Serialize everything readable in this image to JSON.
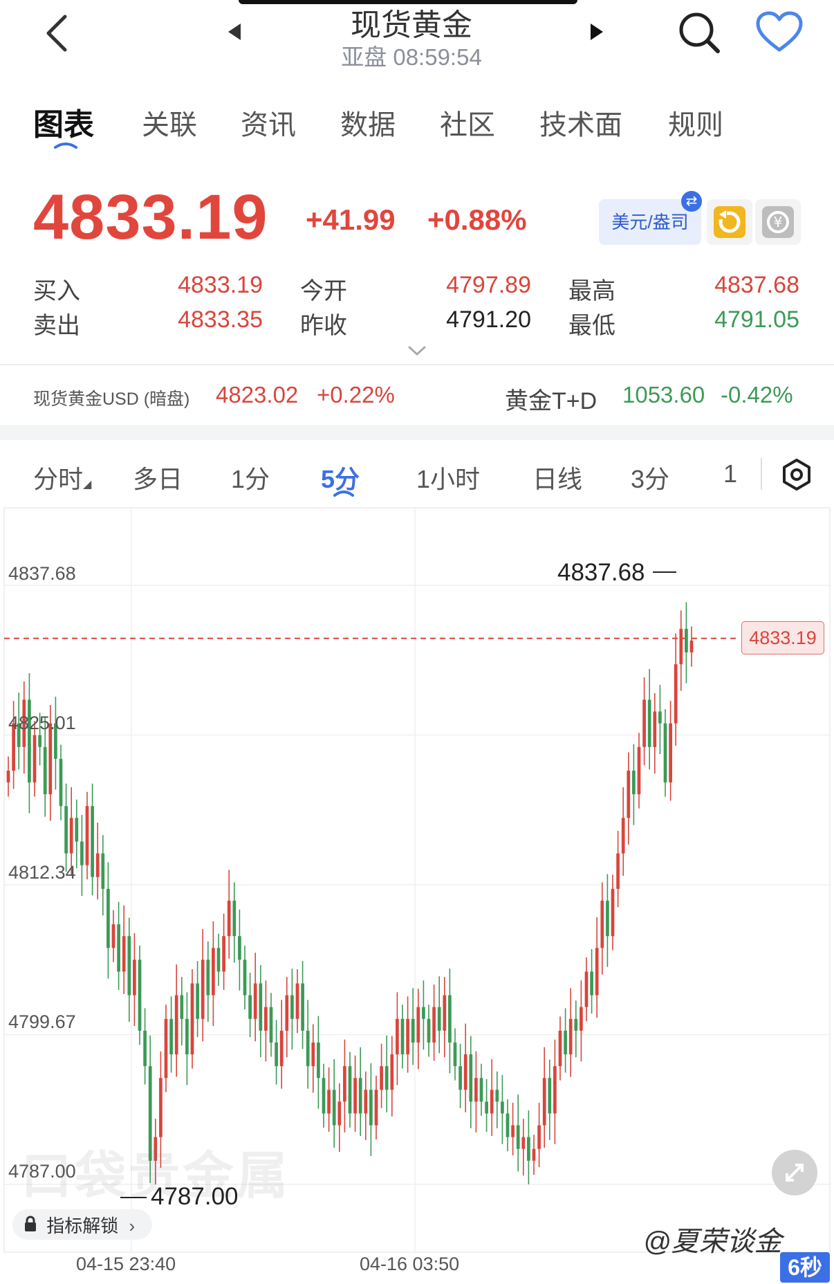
{
  "header": {
    "title": "现货黄金",
    "subtitle": "亚盘 08:59:54",
    "icons": [
      "back-icon",
      "prev-icon",
      "next-icon",
      "search-icon",
      "heart-icon"
    ]
  },
  "main_tabs": [
    "图表",
    "关联",
    "资讯",
    "数据",
    "社区",
    "技术面",
    "规则"
  ],
  "active_main_tab": "图表",
  "quote": {
    "price": "4833.19",
    "change": "+41.99",
    "change_pct": "+0.88%",
    "unit": "美元/盎司",
    "buy_label": "买入",
    "buy": "4833.19",
    "sell_label": "卖出",
    "sell": "4833.35",
    "open_label": "今开",
    "open": "4797.89",
    "prev_close_label": "昨收",
    "prev_close": "4791.20",
    "high_label": "最高",
    "high": "4837.68",
    "low_label": "最低",
    "low": "4791.05"
  },
  "related": {
    "usd_label": "现货黄金USD (暗盘)",
    "usd_price": "4823.02",
    "usd_pct": "+0.22%",
    "td_label": "黄金T+D",
    "td_price": "1053.60",
    "td_pct": "-0.42%"
  },
  "period_tabs": [
    "分时",
    "多日",
    "1分",
    "5分",
    "1小时",
    "日线",
    "3分",
    "1"
  ],
  "active_period": "5分",
  "chart_labels": {
    "y_ticks": [
      "4837.68",
      "4825.01",
      "4812.34",
      "4799.67",
      "4787.00"
    ],
    "high_marker": "4837.68",
    "low_marker": "4787.00",
    "current_tag": "4833.19",
    "x_ticks": [
      "04-15 23:40",
      "04-16 03:50"
    ],
    "watermark": "口袋贵金属",
    "unlock_label": "指标解锁",
    "credit": "@夏荣谈金",
    "refresh_badge": "6秒"
  },
  "colors": {
    "up": "#d9453c",
    "down": "#3c9a56",
    "accent": "#3b6fe6"
  },
  "chart_data": {
    "type": "candlestick",
    "interval": "5分",
    "ylim": [
      4787.0,
      4837.68
    ],
    "y_ticks": [
      4837.68,
      4825.01,
      4812.34,
      4799.67,
      4787.0
    ],
    "x_ticks": [
      "04-15 23:40",
      "04-16 03:50"
    ],
    "reference_line": 4833.19,
    "closes": [
      4822,
      4826,
      4824,
      4828,
      4821,
      4825,
      4824,
      4820,
      4826,
      4823,
      4819,
      4815,
      4818,
      4816,
      4814,
      4819,
      4813,
      4815,
      4812,
      4807,
      4809,
      4805,
      4808,
      4803,
      4806,
      4800,
      4797,
      4789,
      4791,
      4796,
      4801,
      4798,
      4803,
      4801,
      4798,
      4804,
      4801,
      4806,
      4803,
      4807,
      4805,
      4808,
      4811,
      4808,
      4806,
      4803,
      4801,
      4804,
      4800,
      4802,
      4799,
      4797,
      4800,
      4803,
      4801,
      4804,
      4800,
      4797,
      4799,
      4796,
      4793,
      4795,
      4792,
      4794,
      4797,
      4793,
      4796,
      4793,
      4795,
      4792,
      4795,
      4797,
      4795,
      4798,
      4801,
      4798,
      4801,
      4799,
      4802,
      4801,
      4799,
      4802,
      4800,
      4803,
      4799,
      4797,
      4795,
      4798,
      4794,
      4796,
      4794,
      4793,
      4795,
      4794,
      4793,
      4791,
      4792,
      4790,
      4791,
      4789,
      4790,
      4792,
      4796,
      4793,
      4797,
      4800,
      4798,
      4801,
      4800,
      4802,
      4805,
      4803,
      4807,
      4811,
      4808,
      4812,
      4815,
      4818,
      4822,
      4820,
      4824,
      4828,
      4824,
      4827,
      4826,
      4821,
      4826,
      4831,
      4834,
      4832,
      4833
    ]
  }
}
